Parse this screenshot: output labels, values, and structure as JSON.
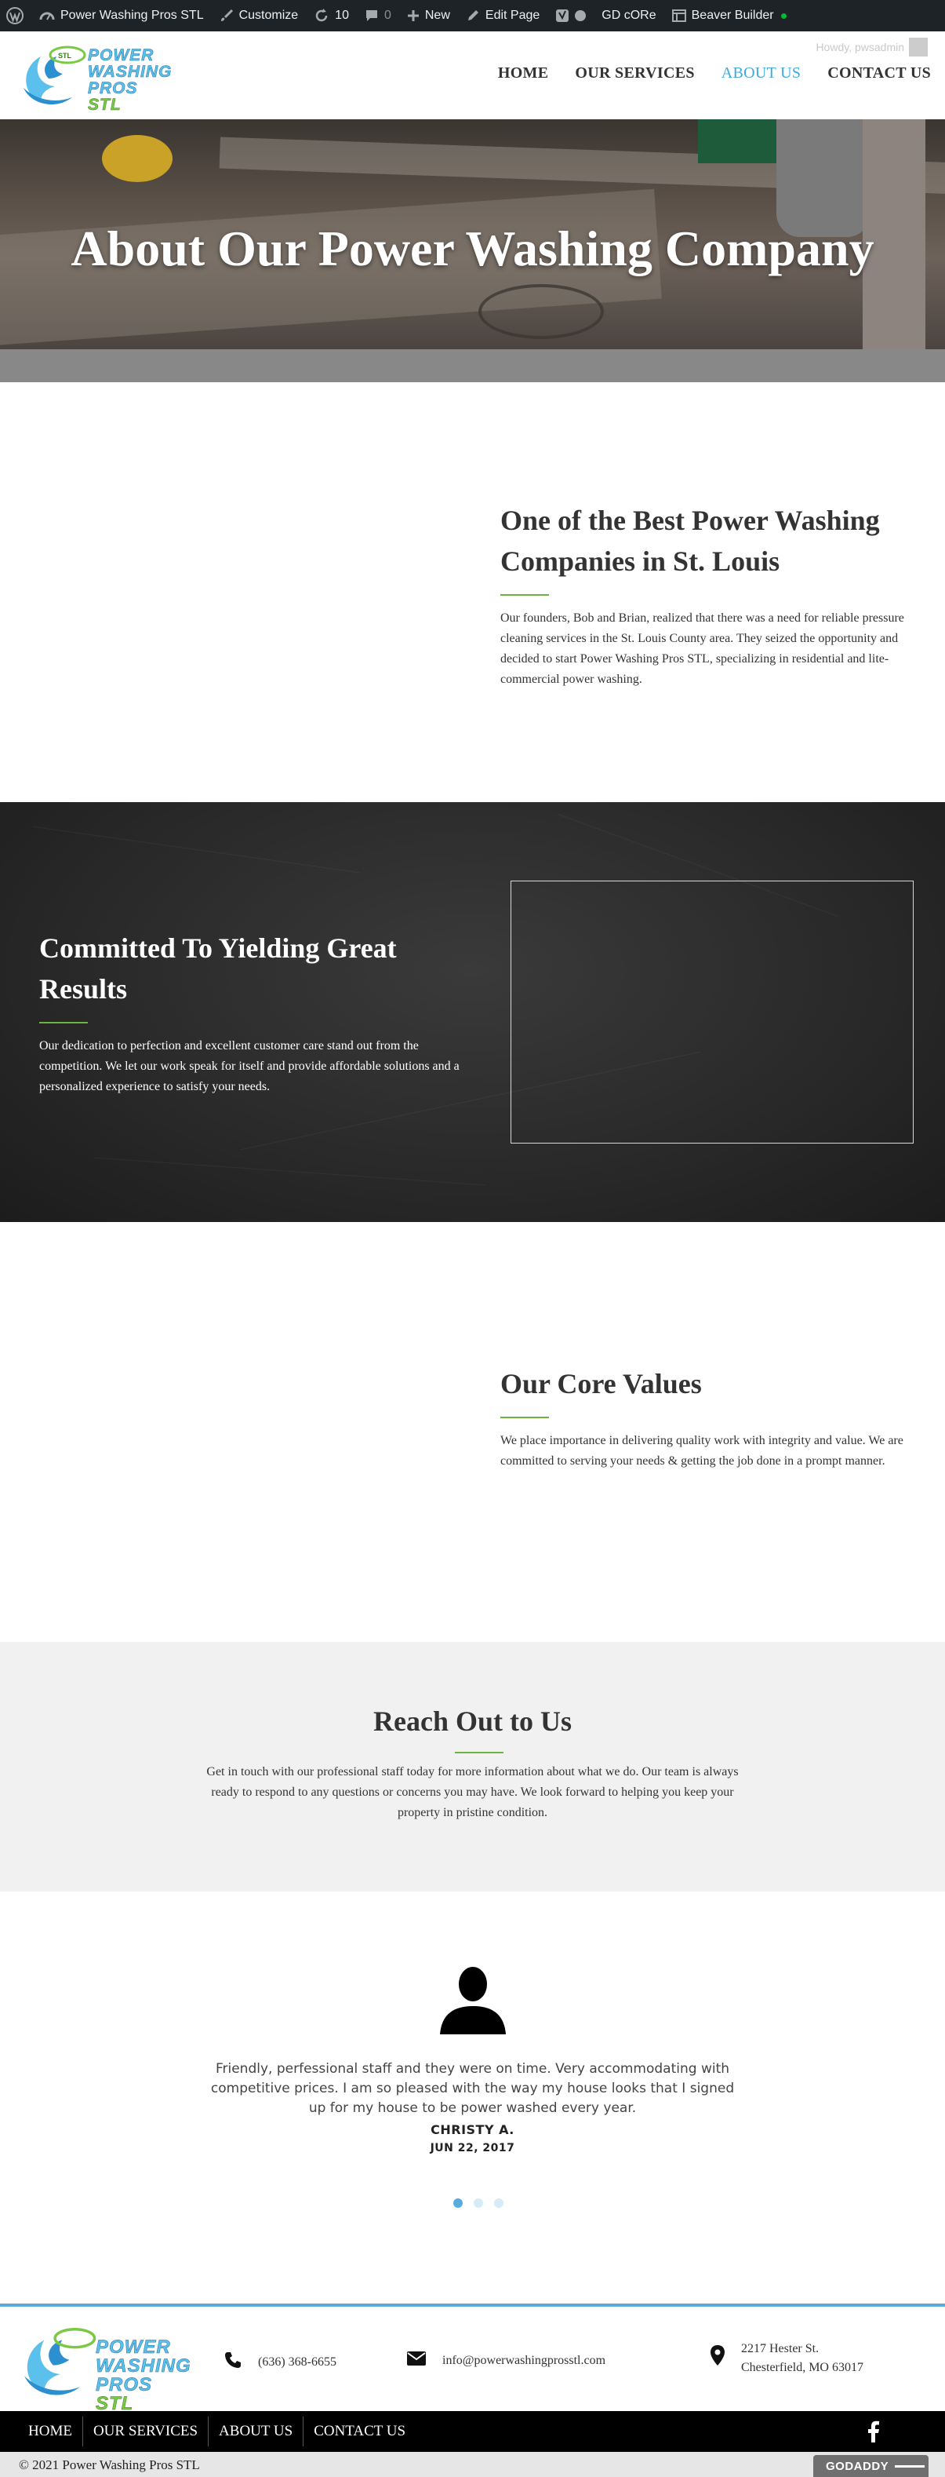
{
  "admin_bar": {
    "site_name": "Power Washing Pros STL",
    "customize": "Customize",
    "updates_count": "10",
    "comments_count": "0",
    "new_label": "New",
    "edit_page": "Edit Page",
    "gd_core": "GD cORe",
    "beaver_builder": "Beaver Builder",
    "howdy": "Howdy, pwsadmin"
  },
  "logo": {
    "line1": "POWER",
    "line2": "WASHING",
    "line3": "PROS",
    "line4": "STL",
    "tag": "STL"
  },
  "nav": {
    "items": [
      {
        "label": "HOME"
      },
      {
        "label": "OUR SERVICES"
      },
      {
        "label": "ABOUT US"
      },
      {
        "label": "CONTACT US"
      }
    ],
    "active": "ABOUT US"
  },
  "hero": {
    "title": "About Our Power Washing Company"
  },
  "best": {
    "heading": "One of the Best Power Washing Companies in St. Louis",
    "body": "Our founders, Bob and Brian, realized that there was a need for reliable pressure cleaning services in the St. Louis County area. They seized the opportunity and decided to start Power Washing Pros STL, specializing in residential and lite-commercial power washing."
  },
  "committed": {
    "heading": "Committed To Yielding Great Results",
    "body": "Our dedication to perfection and excellent customer care stand out from the competition. We let our work speak for itself and provide affordable solutions and a personalized experience to satisfy your needs."
  },
  "values": {
    "heading": "Our Core Values",
    "body": "We place importance in delivering quality work with integrity and value. We are committed to serving your needs & getting the job done in a prompt manner."
  },
  "reach": {
    "heading": "Reach Out to Us",
    "body": "Get in touch with our professional staff today for more information about what we do. Our team is always ready to respond to any questions or concerns you may have. We look forward to helping you keep your property in pristine condition."
  },
  "testimonial": {
    "quote": "Friendly, perfessional staff and they were on time. Very accommodating with competitive prices. I am so pleased with the way my house looks that I signed up for my house to be power washed every year.",
    "author": "CHRISTY A.",
    "date": "JUN 22, 2017",
    "active_slide": 1,
    "slide_count": 3
  },
  "footer": {
    "phone": "(636) 368-6655",
    "email": "info@powerwashingprosstl.com",
    "address_line1": "2217 Hester St.",
    "address_line2": "Chesterfield, MO 63017"
  },
  "bottom_nav": {
    "items": [
      {
        "label": "HOME"
      },
      {
        "label": "OUR SERVICES"
      },
      {
        "label": "ABOUT US"
      },
      {
        "label": "CONTACT US"
      }
    ]
  },
  "copyright": {
    "text": "© 2021 Power Washing Pros STL",
    "badge": "GODADDY"
  },
  "colors": {
    "accent_blue": "#5aace0",
    "accent_green": "#6cb33f",
    "admin_bar": "#1d2327",
    "nav_active": "#3fa9dc"
  },
  "icons": [
    "wordpress-icon",
    "dashboard-icon",
    "brush-icon",
    "updates-icon",
    "comment-icon",
    "plus-icon",
    "pencil-icon",
    "yoast-icon",
    "phone-icon",
    "mail-icon",
    "map-pin-icon",
    "facebook-icon",
    "person-icon"
  ]
}
